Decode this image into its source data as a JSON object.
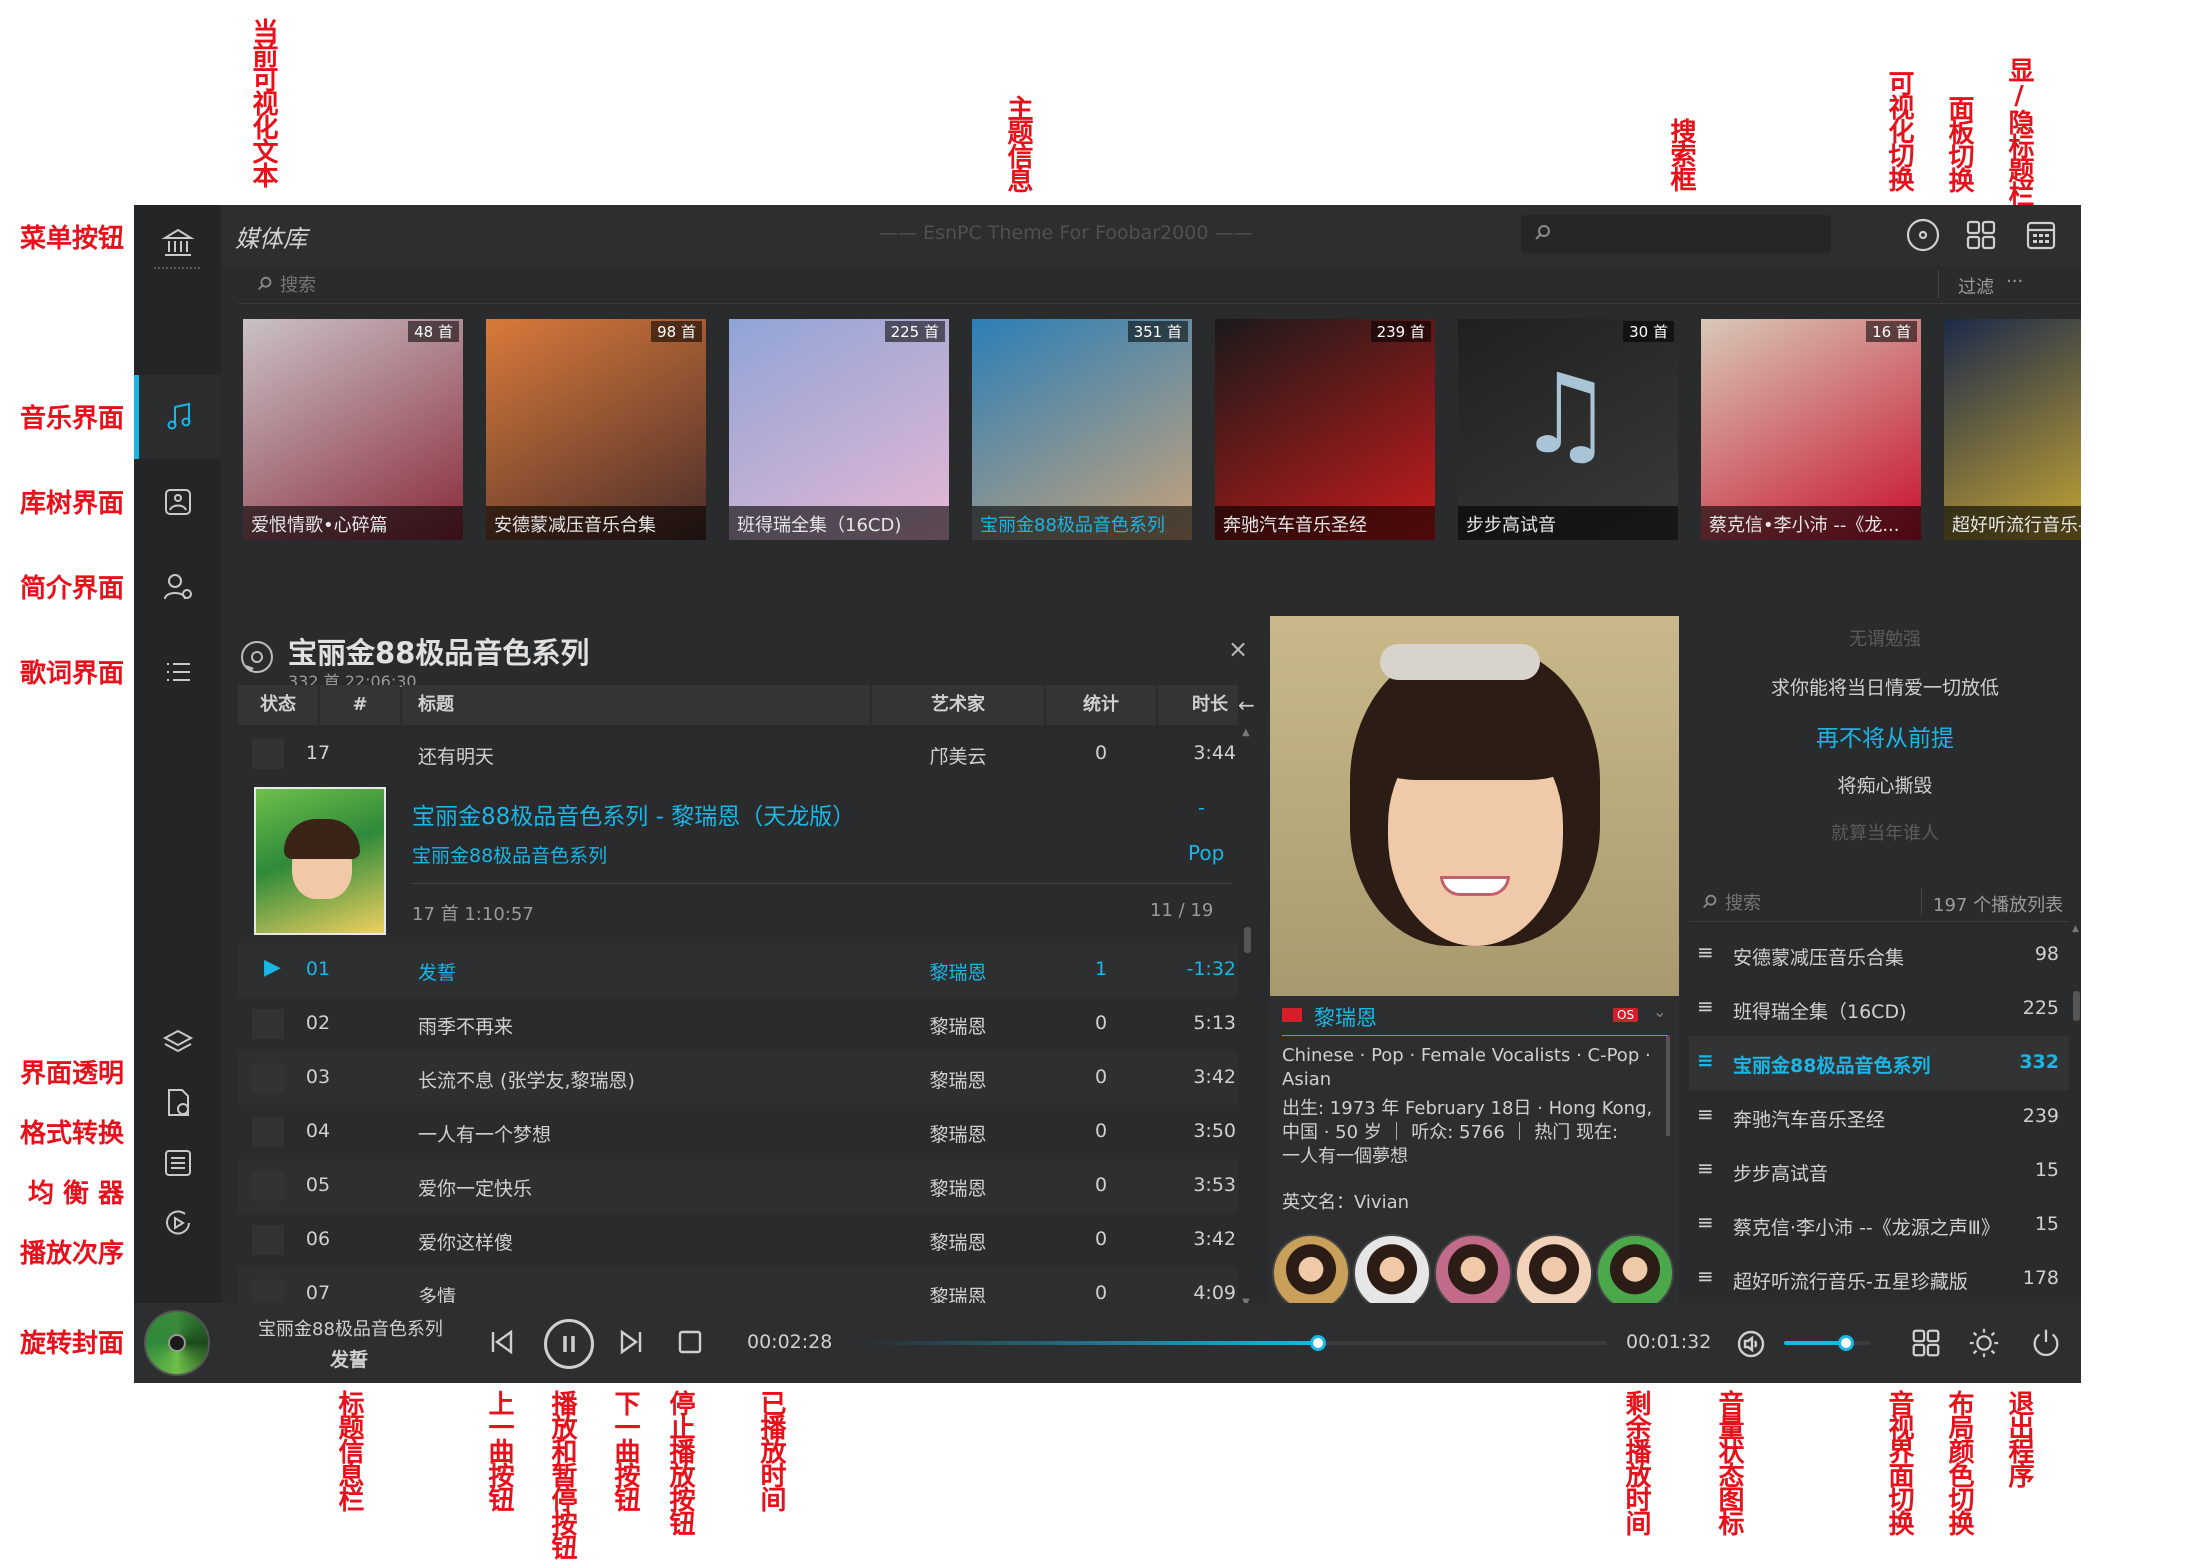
{
  "app": {
    "title": "媒体库",
    "theme_info": "—— EsnPC Theme For Foobar2000 ——",
    "search_placeholder": "",
    "library_search_placeholder": "搜索",
    "filter_label": "过滤",
    "filter_more": "···"
  },
  "annotations": {
    "menu_button": "菜单按钮",
    "music_view": "音乐界面",
    "library_tree": "库树界面",
    "intro_view": "简介界面",
    "lyrics_view": "歌词界面",
    "transparency": "界面透明",
    "format_convert": "格式转换",
    "equalizer": "均 衡 器",
    "play_order": "播放次序",
    "rotate_cover": "旋转封面",
    "current_visual_text": "当前可视化文本",
    "theme_info": "主题信息",
    "search_box": "搜索框",
    "visual_switch": "可视化切换",
    "panel_switch": "面板切换",
    "toggle_titlebar": "显/隐标题栏",
    "title_info_bar": "标题信息栏",
    "prev_button": "上一曲按钮",
    "play_pause_button": "播放和暂停按钮",
    "next_button": "下一曲按钮",
    "stop_button": "停止播放按钮",
    "elapsed_time": "已播放时间",
    "remaining_time": "剩余播放时间",
    "volume_icon": "音量状态图标",
    "av_switch": "音视界面切换",
    "layout_color": "布局颜色切换",
    "exit_program": "退出程序"
  },
  "albums": [
    {
      "caption": "爱恨情歌•心碎篇",
      "count": "48 首",
      "c1": "#c9c2c6",
      "c2": "#8a2a3a"
    },
    {
      "caption": "安德蒙减压音乐合集",
      "count": "98 首",
      "c1": "#d97a3a",
      "c2": "#4a2d2a"
    },
    {
      "caption": "班得瑞全集（16CD)",
      "count": "225 首",
      "c1": "#8fa4d6",
      "c2": "#e7b8d4"
    },
    {
      "caption": "宝丽金88极品音色系列",
      "count": "351 首",
      "c1": "#2b7fb8",
      "c2": "#c7a27a",
      "active": true
    },
    {
      "caption": "奔驰汽车音乐圣经",
      "count": "239 首",
      "c1": "#1a1a1a",
      "c2": "#c81b1b"
    },
    {
      "caption": "步步高试音",
      "count": "30 首",
      "c1": "#202020",
      "c2": "#3a3a3a"
    },
    {
      "caption": "蔡克信•李小沛 --《龙...",
      "count": "16 首",
      "c1": "#d8c9b8",
      "c2": "#c8102e"
    },
    {
      "caption": "超好听流行音乐-",
      "count": "",
      "c1": "#1b2a4a",
      "c2": "#e0b830"
    }
  ],
  "album_header": {
    "title": "宝丽金88极品音色系列",
    "meta": "332 首 22:06:30",
    "close": "×"
  },
  "columns": {
    "status": "状态",
    "number": "#",
    "title": "标题",
    "artist": "艺术家",
    "stats": "统计",
    "duration": "时长"
  },
  "track_prev": {
    "num": "17",
    "title": "还有明天",
    "artist": "邝美云",
    "stats": "0",
    "duration": "3:44"
  },
  "group": {
    "title": "宝丽金88极品音色系列 - 黎瑞恩（天龙版）",
    "subtitle": "宝丽金88极品音色系列",
    "dash": "-",
    "genre": "Pop",
    "meta": "17 首 1:10:57",
    "position": "11 / 19"
  },
  "tracks": [
    {
      "num": "01",
      "title": "发誓",
      "artist": "黎瑞恩",
      "stats": "1",
      "duration": "-1:32",
      "playing": true
    },
    {
      "num": "02",
      "title": "雨季不再来",
      "artist": "黎瑞恩",
      "stats": "0",
      "duration": "5:13"
    },
    {
      "num": "03",
      "title": "长流不息 (张学友,黎瑞恩)",
      "artist": "黎瑞恩",
      "stats": "0",
      "duration": "3:42"
    },
    {
      "num": "04",
      "title": "一人有一个梦想",
      "artist": "黎瑞恩",
      "stats": "0",
      "duration": "3:50"
    },
    {
      "num": "05",
      "title": "爱你一定快乐",
      "artist": "黎瑞恩",
      "stats": "0",
      "duration": "3:53"
    },
    {
      "num": "06",
      "title": "爱你这样傻",
      "artist": "黎瑞恩",
      "stats": "0",
      "duration": "3:42"
    },
    {
      "num": "07",
      "title": "多情",
      "artist": "黎瑞恩",
      "stats": "0",
      "duration": "4:09"
    }
  ],
  "artist": {
    "name": "黎瑞恩",
    "flag_label": "OS",
    "tags": "Chinese · Pop · Female Vocalists · C-Pop · Asian",
    "bio_line1": "出生: 1973 年 February 18日 · Hong Kong,",
    "bio_line2": "中国 · 50 岁 ｜ 听众: 5766 ｜ 热门 现在:",
    "bio_line3": "一人有一個夢想",
    "english_name": "英文名：Vivian"
  },
  "lyrics": [
    {
      "text": "无谓勉强",
      "state": "faded"
    },
    {
      "text": "求你能将当日情爱一切放低",
      "state": "normal"
    },
    {
      "text": "再不将从前提",
      "state": "current"
    },
    {
      "text": "将痴心撕毁",
      "state": "normal"
    },
    {
      "text": "就算当年谁人",
      "state": "faded"
    }
  ],
  "playlists": {
    "search_placeholder": "搜索",
    "count_label": "197 个播放列表",
    "items": [
      {
        "name": "安德蒙减压音乐合集",
        "count": "98"
      },
      {
        "name": "班得瑞全集（16CD)",
        "count": "225"
      },
      {
        "name": "宝丽金88极品音色系列",
        "count": "332",
        "active": true
      },
      {
        "name": "奔驰汽车音乐圣经",
        "count": "239"
      },
      {
        "name": "步步高试音",
        "count": "15"
      },
      {
        "name": "蔡克信·李小沛 --《龙源之声Ⅲ》",
        "count": "15"
      },
      {
        "name": "超好听流行音乐-五星珍藏版",
        "count": "178"
      }
    ]
  },
  "player": {
    "album": "宝丽金88极品音色系列",
    "track": "发誓",
    "elapsed": "00:02:28",
    "remaining": "00:01:32",
    "progress": 0.617,
    "volume": 0.72
  },
  "colors": {
    "accent": "#19b6e6",
    "annotation": "#e8101a",
    "background": "#2a2b2d"
  }
}
